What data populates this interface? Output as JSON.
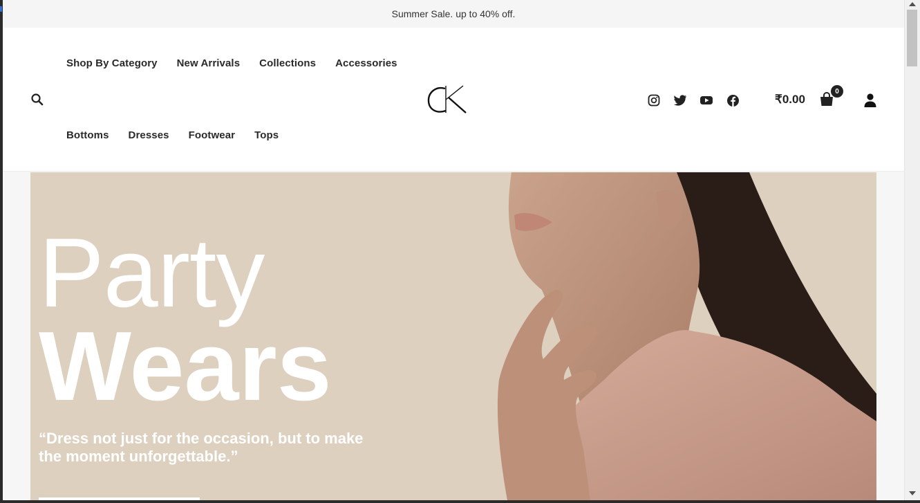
{
  "announcement": {
    "text": "Summer Sale. up to 40% off."
  },
  "nav": {
    "primary": [
      "Shop By Category",
      "New Arrivals",
      "Collections",
      "Accessories"
    ],
    "secondary": [
      "Bottoms",
      "Dresses",
      "Footwear",
      "Tops"
    ]
  },
  "logo": {
    "text": "CK"
  },
  "social": [
    "instagram-icon",
    "twitter-icon",
    "youtube-icon",
    "facebook-icon"
  ],
  "cart": {
    "total": "₹0.00",
    "count": "0"
  },
  "hero": {
    "title_line1": "Party",
    "title_line2": "Wears",
    "quote": "“Dress not just for the occasion, but to make the moment unforgettable.”"
  },
  "colors": {
    "hero_bg": "#ddd0bf",
    "header_bg": "#ffffff",
    "announce_bg": "#f5f5f5",
    "text": "#2a2a2a"
  }
}
